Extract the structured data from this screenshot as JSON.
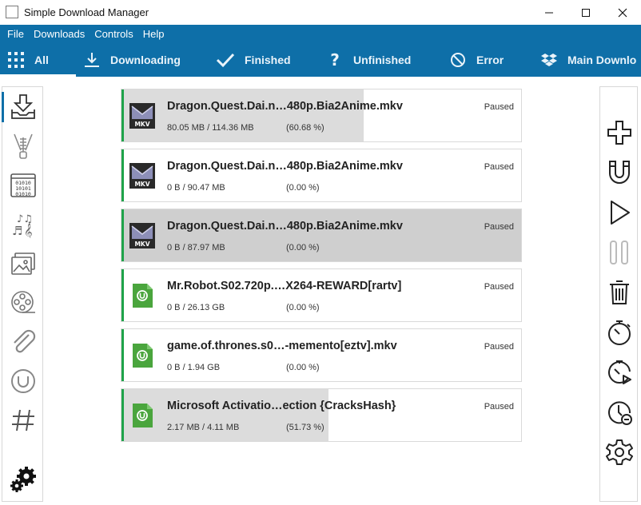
{
  "window": {
    "title": "Simple Download Manager",
    "min_glyph": "—",
    "max_glyph": "☐",
    "close_glyph": "✕"
  },
  "menu": [
    {
      "label": "File"
    },
    {
      "label": "Downloads"
    },
    {
      "label": "Controls"
    },
    {
      "label": "Help"
    }
  ],
  "tabs": [
    {
      "label": "All",
      "icon": "grid-icon"
    },
    {
      "label": "Downloading",
      "icon": "download-icon"
    },
    {
      "label": "Finished",
      "icon": "check-icon"
    },
    {
      "label": "Unfinished",
      "icon": "question-icon"
    },
    {
      "label": "Error",
      "icon": "error-icon"
    },
    {
      "label": "Main Downlo",
      "icon": "dropbox-icon"
    }
  ],
  "left_sidebar": [
    {
      "icon": "download-tray-icon"
    },
    {
      "icon": "zip-icon"
    },
    {
      "icon": "binary-icon"
    },
    {
      "icon": "music-icon"
    },
    {
      "icon": "image-icon"
    },
    {
      "icon": "film-reel-icon"
    },
    {
      "icon": "paperclip-icon"
    },
    {
      "icon": "utorrent-icon"
    },
    {
      "icon": "hash-icon"
    },
    {
      "icon": "gears-icon"
    }
  ],
  "right_sidebar": [
    {
      "icon": "add-icon"
    },
    {
      "icon": "magnet-icon"
    },
    {
      "icon": "play-icon"
    },
    {
      "icon": "pause-icon"
    },
    {
      "icon": "trash-icon"
    },
    {
      "icon": "stopwatch-icon"
    },
    {
      "icon": "stopwatch-play-icon"
    },
    {
      "icon": "clock-minus-icon"
    },
    {
      "icon": "settings-icon"
    }
  ],
  "downloads": [
    {
      "name": "Dragon.Quest.Dai.n…480p.Bia2Anime.mkv",
      "size": "80.05 MB / 114.36 MB",
      "percent": "(60.68 %)",
      "progress": 0.6068,
      "status": "Paused",
      "type": "mkv"
    },
    {
      "name": "Dragon.Quest.Dai.n…480p.Bia2Anime.mkv",
      "size": "0 B / 90.47 MB",
      "percent": "(0.00 %)",
      "progress": 0.0,
      "status": "Paused",
      "type": "mkv"
    },
    {
      "name": "Dragon.Quest.Dai.n…480p.Bia2Anime.mkv",
      "size": "0 B / 87.97 MB",
      "percent": "(0.00 %)",
      "progress": 0.0,
      "status": "Paused",
      "type": "mkv",
      "selected": true
    },
    {
      "name": "Mr.Robot.S02.720p.…X264-REWARD[rartv]",
      "size": "0 B / 26.13 GB",
      "percent": "(0.00 %)",
      "progress": 0.0,
      "status": "Paused",
      "type": "torrent"
    },
    {
      "name": "game.of.thrones.s0…-memento[eztv].mkv",
      "size": "0 B / 1.94 GB",
      "percent": "(0.00 %)",
      "progress": 0.0,
      "status": "Paused",
      "type": "torrent"
    },
    {
      "name": "Microsoft Activatio…ection {CracksHash}",
      "size": "2.17 MB / 4.11 MB",
      "percent": "(51.73 %)",
      "progress": 0.5173,
      "status": "Paused",
      "type": "torrent"
    }
  ],
  "colors": {
    "accent_blue": "#0e6fa8",
    "accent_green": "#1fa34a",
    "utorrent_green": "#4aa53d"
  }
}
